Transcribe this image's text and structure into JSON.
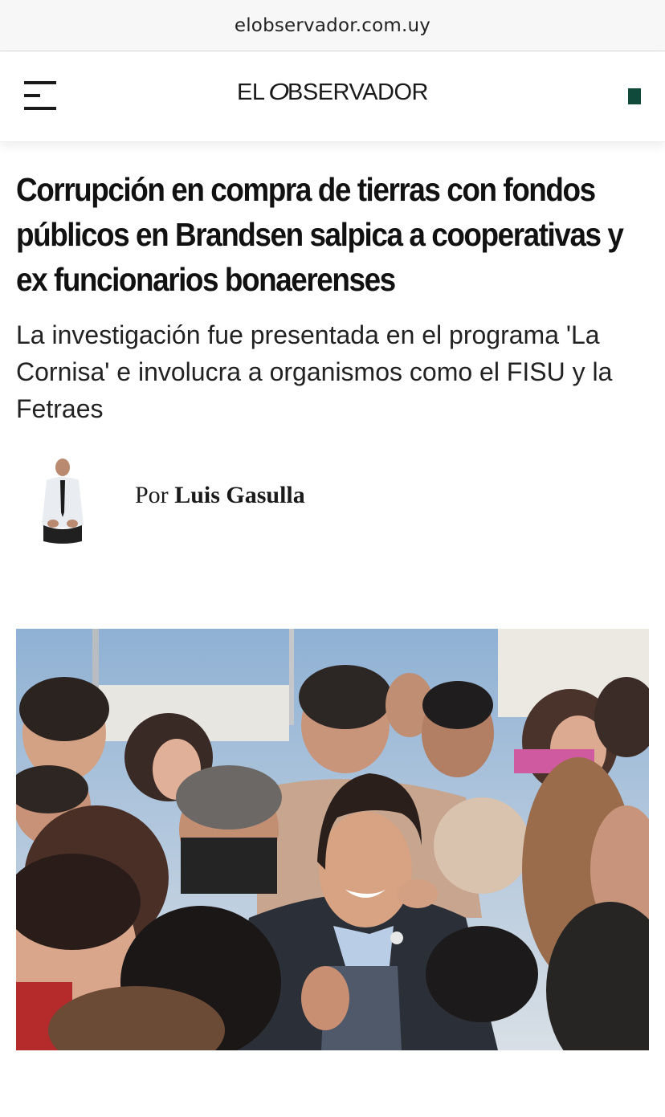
{
  "browser": {
    "url": "elobservador.com.uy"
  },
  "header": {
    "logo_left": "EL ",
    "logo_o": "O",
    "logo_right": "BSERVADOR"
  },
  "article": {
    "headline": "Corrupción en compra de tierras con fondos públicos en Brandsen salpica a cooperativas y ex funcionarios bonaerenses",
    "subheadline": "La investigación fue presentada en el programa 'La Cornisa' e involucra a organismos como el FISU y la Fetraes",
    "byline_prefix": "Por",
    "author": "Luis Gasulla"
  },
  "colors": {
    "brand_square": "#0f4a3a",
    "text": "#111111"
  }
}
